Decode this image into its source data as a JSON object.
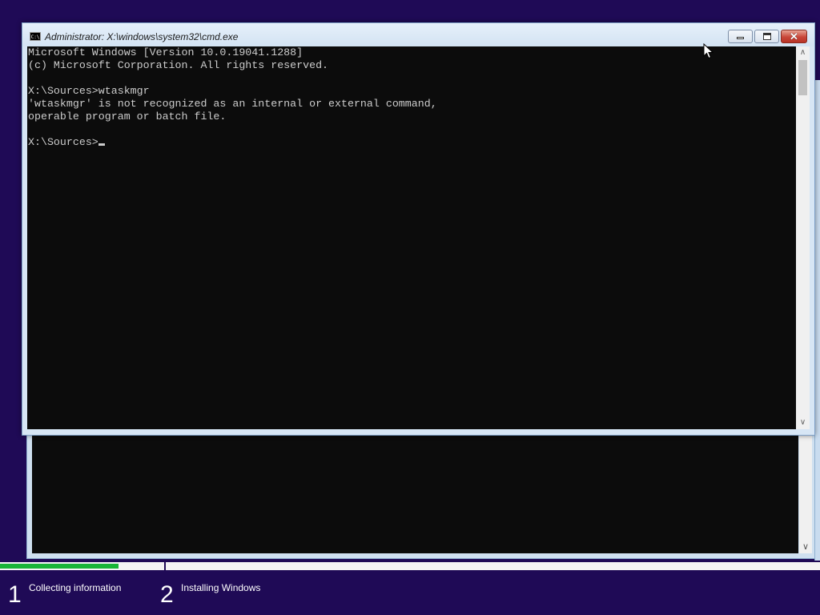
{
  "window": {
    "title": "Administrator: X:\\windows\\system32\\cmd.exe",
    "icon": "cmd-icon",
    "icon_text": "C:\\"
  },
  "console": {
    "lines": [
      "Microsoft Windows [Version 10.0.19041.1288]",
      "(c) Microsoft Corporation. All rights reserved.",
      "",
      "X:\\Sources>wtaskmgr",
      "'wtaskmgr' is not recognized as an internal or external command,",
      "operable program or batch file.",
      "",
      "X:\\Sources>"
    ],
    "text_color": "#cccccc",
    "background": "#0c0c0c"
  },
  "setup": {
    "progress": 0.145,
    "accent": "#18b436",
    "steps": [
      {
        "number": "1",
        "label": "Collecting information"
      },
      {
        "number": "2",
        "label": "Installing Windows"
      }
    ]
  },
  "colors": {
    "desktop": "#1f0a56",
    "frame": "#d7e6f5"
  }
}
